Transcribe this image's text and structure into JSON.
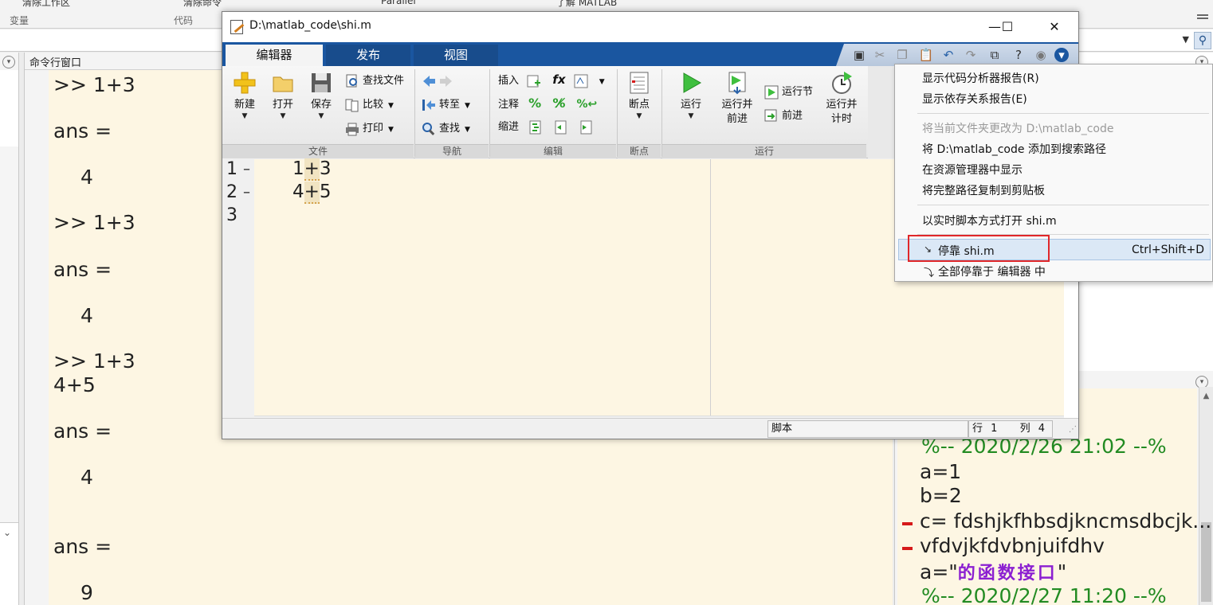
{
  "toolstrip": {
    "top_frags": [
      "清除工作区",
      "清除命令",
      "Parallel",
      "了解 MATLAB"
    ],
    "sections": [
      "变量",
      "代码"
    ]
  },
  "command_window": {
    "title": "命令行窗口",
    "lines": [
      ">> 1+3",
      "ans =",
      "4",
      ">> 1+3",
      "ans =",
      "4",
      ">> 1+3",
      "4+5",
      "ans =",
      "4",
      "ans =",
      "9"
    ]
  },
  "history": {
    "lines": [
      "%-- 2020/2/26 21:02 --%",
      "a=1",
      "b=2",
      "c= fdshjkfhbsdjkncmsdbcjk...",
      "vfdvjkfdvbnjuifdhv",
      "a=\"",
      "的函数接口",
      "\"",
      "%-- 2020/2/27 11:20 --%"
    ]
  },
  "editor": {
    "title": "D:\\matlab_code\\shi.m",
    "tabs": [
      "编辑器",
      "发布",
      "视图"
    ],
    "groups": {
      "file": {
        "label": "文件",
        "new": "新建",
        "open": "打开",
        "save": "保存",
        "find_files": "查找文件",
        "compare": "比较",
        "print": "打印"
      },
      "navigate": {
        "label": "导航",
        "goto": "转至",
        "find": "查找"
      },
      "edit": {
        "label": "编辑",
        "insert": "插入",
        "comment": "注释",
        "indent": "缩进",
        "fx": "fx"
      },
      "breakpoints": {
        "label": "断点",
        "breakpoints": "断点"
      },
      "run": {
        "label": "运行",
        "run": "运行",
        "run_advance_1": "运行并",
        "run_advance_2": "前进",
        "run_section": "运行节",
        "advance": "前进",
        "run_time_1": "运行并",
        "run_time_2": "计时"
      }
    },
    "line_numbers": [
      "1",
      "2",
      "3"
    ],
    "code": [
      {
        "pre": "1",
        "hl": "+",
        "post": "3"
      },
      {
        "pre": "4",
        "hl": "+",
        "post": "5"
      }
    ],
    "status": {
      "type": "脚本",
      "row_label": "行",
      "row": "1",
      "col_label": "列",
      "col": "4"
    }
  },
  "context_menu": {
    "items": [
      {
        "label": "显示代码分析器报告(R)",
        "enabled": true
      },
      {
        "label": "显示依存关系报告(E)",
        "enabled": true
      },
      {
        "label": "将当前文件夹更改为 D:\\matlab_code",
        "enabled": false
      },
      {
        "label": "将 D:\\matlab_code 添加到搜索路径",
        "enabled": true
      },
      {
        "label": "在资源管理器中显示",
        "enabled": true
      },
      {
        "label": "将完整路径复制到剪贴板",
        "enabled": true
      },
      {
        "label": "以实时脚本方式打开 shi.m",
        "enabled": true
      },
      {
        "label": "停靠 shi.m",
        "enabled": true,
        "shortcut": "Ctrl+Shift+D"
      },
      {
        "label": "全部停靠于 编辑器 中",
        "enabled": true
      }
    ]
  },
  "colors": {
    "ribbon_blue": "#1a56a0",
    "comment_green": "#228b22",
    "string_purple": "#8b1fd1",
    "highlight_red": "#e0272a"
  }
}
